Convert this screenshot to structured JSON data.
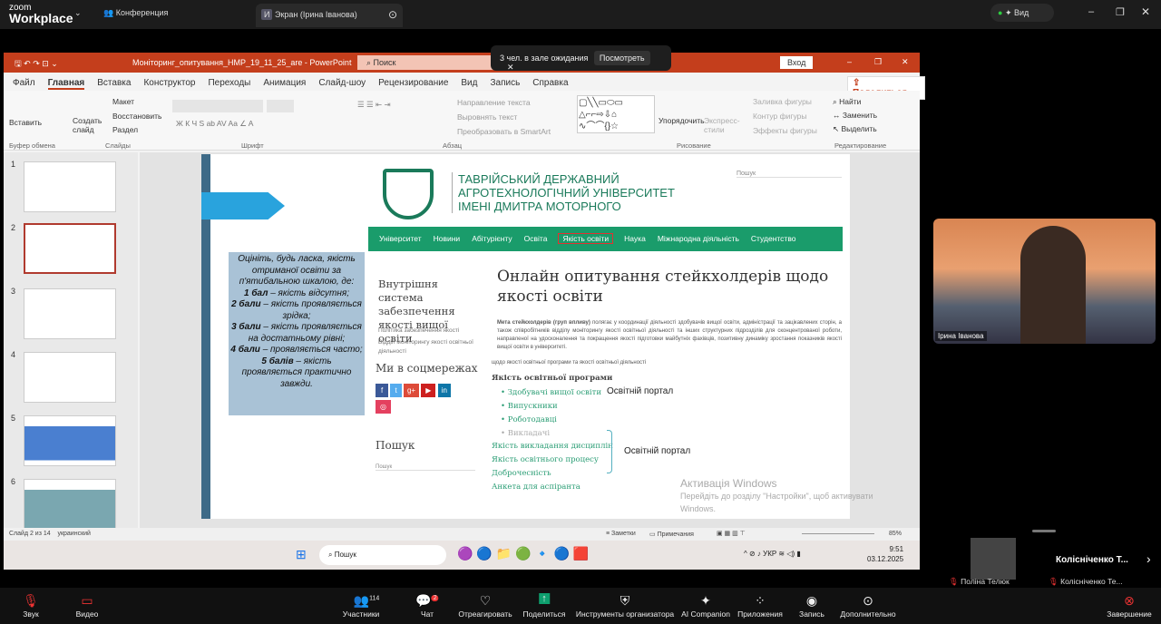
{
  "zoom": {
    "logo_small": "zoom",
    "logo_big": "Workplace",
    "meeting_tab": "Конференция",
    "share_tab": "Экран (Ірина Іванова)",
    "share_avatar": "И",
    "view_label": "Вид",
    "waiting": {
      "text": "3 чел. в зале ожидания",
      "button": "Посмотреть"
    },
    "participant_main": "Ірина Іванова",
    "participant_small": "Поліна Телюк",
    "participant_self": "Колісніченко Те...",
    "participant_header": "Колісніченко Т...",
    "toolbar": [
      {
        "label": "Звук",
        "icon": "mic-muted-icon"
      },
      {
        "label": "Видео",
        "icon": "video-off-icon"
      },
      {
        "label": "Участники",
        "icon": "participants-icon",
        "count": "114"
      },
      {
        "label": "Чат",
        "icon": "chat-icon",
        "badge": "2"
      },
      {
        "label": "Отреагировать",
        "icon": "heart-icon"
      },
      {
        "label": "Поделиться",
        "icon": "share-icon"
      },
      {
        "label": "Инструменты организатора",
        "icon": "shield-icon"
      },
      {
        "label": "AI Companion",
        "icon": "sparkle-icon"
      },
      {
        "label": "Приложения",
        "icon": "apps-icon"
      },
      {
        "label": "Запись",
        "icon": "record-icon"
      },
      {
        "label": "Дополнительно",
        "icon": "more-icon"
      },
      {
        "label": "Завершение",
        "icon": "end-icon"
      }
    ]
  },
  "ppt": {
    "title": "Моніторинг_опитування_НМР_19_11_25_are - PowerPoint",
    "search": "Поиск",
    "signin": "Вход",
    "share": "Поделиться",
    "menus": [
      "Файл",
      "Главная",
      "Вставка",
      "Конструктор",
      "Переходы",
      "Анимация",
      "Слайд-шоу",
      "Рецензирование",
      "Вид",
      "Запись",
      "Справка"
    ],
    "ribbon": {
      "paste": "Вставить",
      "clipboard": "Буфер обмена",
      "new_slide": "Создать слайд",
      "layout": "Макет",
      "reset": "Восстановить",
      "section": "Раздел",
      "slides": "Слайды",
      "font": "Шрифт",
      "text_dir": "Направление текста",
      "align_text": "Выровнять текст",
      "smartart": "Преобразовать в SmartArt",
      "paragraph": "Абзац",
      "arrange": "Упорядочить",
      "quick_styles": "Экспресс-стили",
      "fill": "Заливка фигуры",
      "outline": "Контур фигуры",
      "effects": "Эффекты фигуры",
      "drawing": "Рисование",
      "find": "Найти",
      "replace": "Заменить",
      "select": "Выделить",
      "editing": "Редактирование"
    },
    "thumbs": [
      "1",
      "2",
      "3",
      "4",
      "5",
      "6"
    ],
    "status": {
      "slide": "Слайд 2 из 14",
      "lang": "украинский",
      "notes": "Заметки",
      "comments": "Примечания",
      "zoom": "85%"
    },
    "slide": {
      "instructions": [
        "Оцініть, будь ласка, якість отриманої освіти за п'ятибальною шкалою, де:",
        "1 бал",
        "– якість відсутня;",
        "2 бали",
        "– якість проявляється зрідка;",
        "3 бали",
        "– якість проявляється на достатньому рівні;",
        "4 бали",
        "– проявляється часто;",
        "5 балів",
        "– якість проявляється практично завжди."
      ],
      "univ": [
        "ТАВРІЙСЬКИЙ ДЕРЖАВНИЙ",
        "АГРОТЕХНОЛОГІЧНИЙ УНІВЕРСИТЕТ",
        "ІМЕНІ ДМИТРА МОТОРНОГО"
      ],
      "search": "Пошук",
      "nav": [
        "Університет",
        "Новини",
        "Абітурієнту",
        "Освіта",
        "Якість освіти",
        "Наука",
        "Міжнародна діяльність",
        "Студентство"
      ],
      "sidebar_title": "Внутрішня система забезпечення якості вищої освіти",
      "sidebar_links": [
        "Політика забезпечення якості",
        "Відділ моніторингу якості освітньої діяльності"
      ],
      "social": "Ми в соцмережах",
      "search_title": "Пошук",
      "search_ph": "Пошук",
      "heading": "Онлайн опитування стейкхолдерів щодо якості освіти",
      "para_bold": "Мета стейкхолдерів (груп впливу)",
      "para": " полягає у координації діяльності здобувачів вищої освіти, адміністрації та зацікавлених сторін, а також співробітників відділу моніторингу якості освітньої діяльності та інших структурних підрозділів для сконцентрованої роботи, направленої на удосконалення та покращення якості підготовки майбутніх фахівців, позитивну динаміку зростання показників якості вищої освіти в університеті.",
      "sub": "щодо якості освітньої програми та якості освітньої діяльності",
      "program": "Якість освітньої програми",
      "items": [
        "Здобувачі вищої освіти",
        "Випускники",
        "Роботодавці",
        "Викладачі"
      ],
      "links": [
        "Якість викладання дисциплін",
        "Якість освітнього процесу",
        "Доброчесність",
        "Анкета для аспіранта"
      ],
      "portal": "Освітній портал"
    },
    "activation": {
      "title": "Активація Windows",
      "text": "Перейдіть до розділу \"Настройки\", щоб активувати Windows."
    }
  },
  "taskbar": {
    "search": "Пошук",
    "lang": "УКР",
    "time": "9:51",
    "date": "03.12.2025"
  },
  "colors": {
    "ppt_red": "#c43e1c",
    "univ_green": "#1a9c6b",
    "zoom_share": "#0e9f6e"
  }
}
